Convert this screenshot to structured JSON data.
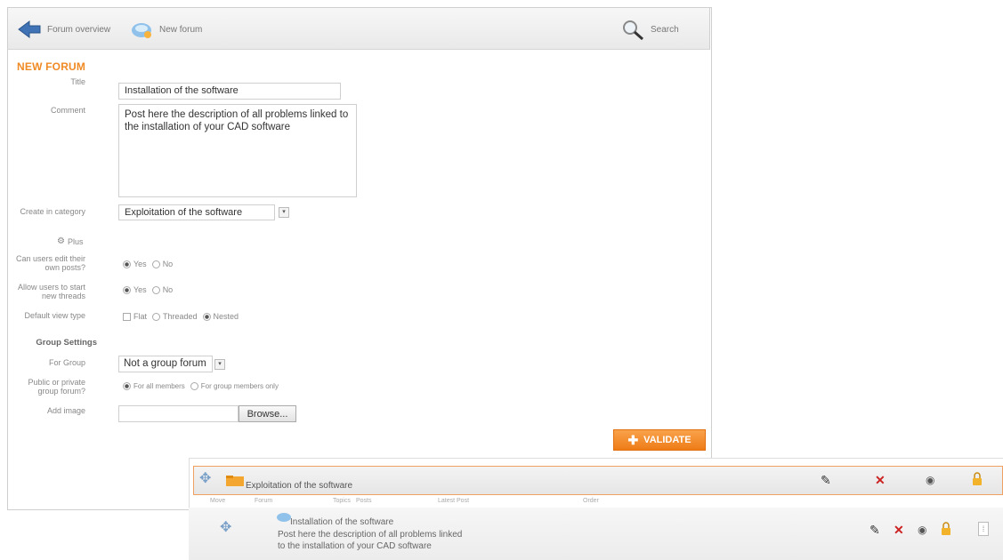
{
  "toolbar": {
    "forum_overview": "Forum overview",
    "new_forum": "New forum",
    "search": "Search"
  },
  "form": {
    "heading": "NEW FORUM",
    "title_label": "Title",
    "title_value": "Installation of the software",
    "comment_label": "Comment",
    "comment_value": "Post here the description of all problems linked to the installation of your CAD software",
    "category_label": "Create in category",
    "category_value": "Exploitation of the software",
    "plus_label": "Plus",
    "edit_posts_label": "Can users edit their own posts?",
    "start_threads_label": "Allow users to start new threads",
    "view_type_label": "Default view type",
    "yes": "Yes",
    "no": "No",
    "flat": "Flat",
    "threaded": "Threaded",
    "nested": "Nested",
    "group_settings": "Group Settings",
    "for_group_label": "For Group",
    "for_group_value": "Not a group forum",
    "public_private_label": "Public or private group forum?",
    "for_all_members": "For all members",
    "for_group_members_only": "For group members only",
    "add_image_label": "Add image",
    "browse": "Browse...",
    "validate": "VALIDATE"
  },
  "list": {
    "category_name": "Exploitation of the software",
    "columns": [
      "Move",
      "Forum",
      "Topics",
      "Posts",
      "Latest Post",
      "Order"
    ],
    "forum_title": "Installation of the software",
    "forum_desc_line1": "Post here the description of all problems linked",
    "forum_desc_line2": "to the installation of your CAD software"
  },
  "colors": {
    "accent": "#f08a24",
    "delete": "#cc2222"
  },
  "icons": [
    "back-arrow-icon",
    "new-forum-icon",
    "search-icon",
    "move-icon",
    "folder-icon",
    "edit-icon",
    "delete-icon",
    "visibility-icon",
    "lock-icon",
    "order-icon"
  ]
}
